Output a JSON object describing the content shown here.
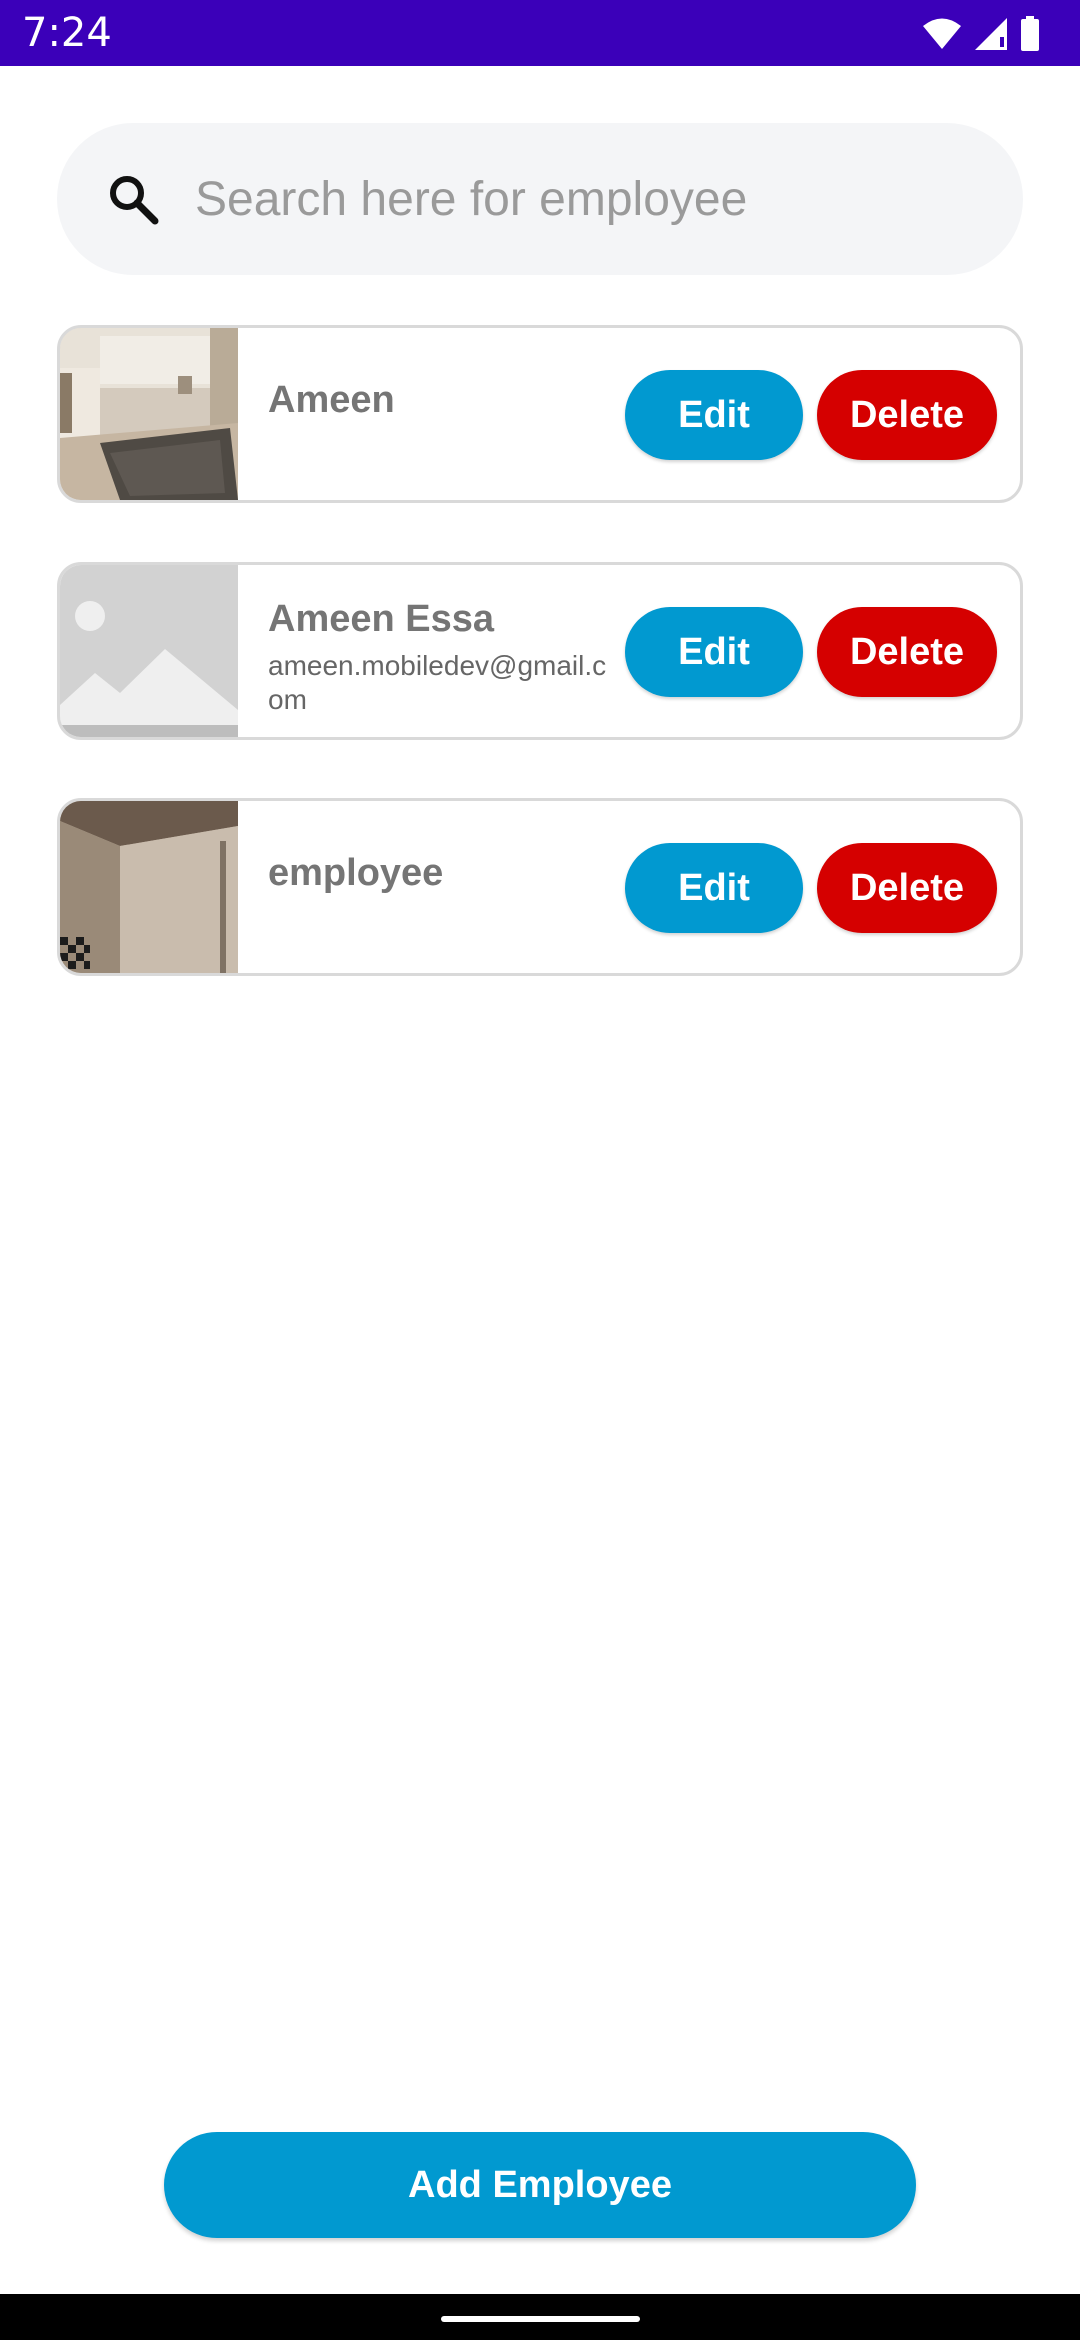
{
  "status_bar": {
    "time": "7:24",
    "icons": [
      "wifi-icon",
      "cell-signal-icon",
      "battery-icon"
    ],
    "background": "#3b00b9"
  },
  "search": {
    "placeholder": "Search here for employee",
    "value": "",
    "icon": "search-icon"
  },
  "employees": [
    {
      "name": "Ameen",
      "email": "",
      "photo": "living-room-photo",
      "edit_label": "Edit",
      "delete_label": "Delete"
    },
    {
      "name": "Ameen Essa",
      "email": "ameen.mobiledev@gmail.com",
      "photo": "image-placeholder-icon",
      "edit_label": "Edit",
      "delete_label": "Delete"
    },
    {
      "name": "employee",
      "email": "",
      "photo": "room-corner-photo",
      "edit_label": "Edit",
      "delete_label": "Delete"
    }
  ],
  "actions": {
    "add_employee_label": "Add Employee"
  },
  "colors": {
    "primary": "#0199d0",
    "danger": "#d50000",
    "status_bar": "#3b00b9",
    "search_background": "#f4f5f7",
    "name_text": "#757575"
  }
}
